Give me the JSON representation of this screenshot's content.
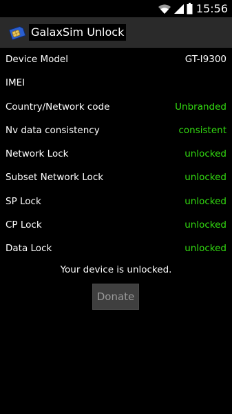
{
  "status_bar": {
    "time": "15:56",
    "icons": [
      "wifi-icon",
      "signal-icon",
      "battery-icon"
    ]
  },
  "app": {
    "title": "GalaxSim Unlock",
    "icon": "sim-card-icon"
  },
  "info_rows": [
    {
      "label": "Device Model",
      "value": "GT-I9300"
    },
    {
      "label": "IMEI",
      "value": ""
    },
    {
      "label": "Country/Network code",
      "value": "Unbranded"
    },
    {
      "label": "Nv data consistency",
      "value": "consistent"
    },
    {
      "label": "Network Lock",
      "value": "unlocked"
    },
    {
      "label": "Subset Network Lock",
      "value": "unlocked"
    },
    {
      "label": "SP Lock",
      "value": "unlocked"
    },
    {
      "label": "CP Lock",
      "value": "unlocked"
    },
    {
      "label": "Data Lock",
      "value": "unlocked"
    }
  ],
  "status_message": "Your device is unlocked.",
  "donate_label": "Donate",
  "colors": {
    "background": "#000000",
    "title_bar": "#2a2a2a",
    "status_green": "#33dd11",
    "button_bg": "#3f3f3f",
    "button_text": "#9a9a9a"
  }
}
